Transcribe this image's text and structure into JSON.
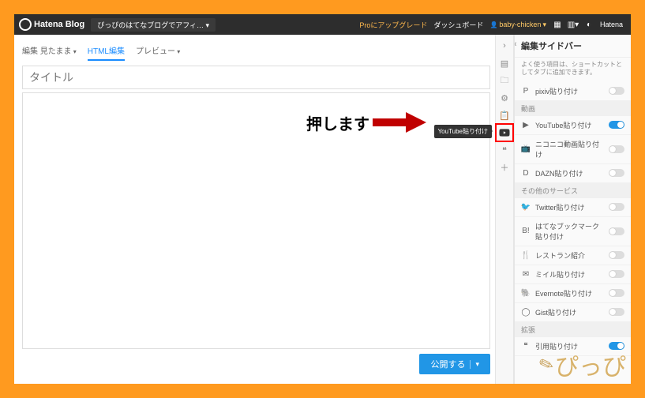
{
  "topbar": {
    "brand": "Hatena Blog",
    "blogname": "ぴっぴのはてなブログでアフィ…",
    "pro": "Proにアップグレード",
    "dashboard": "ダッシュボード",
    "user": "baby-chicken",
    "hatena": "Hatena"
  },
  "tabs": {
    "edit": "編集 見たまま",
    "html": "HTML編集",
    "preview": "プレビュー"
  },
  "editor": {
    "title_placeholder": "タイトル",
    "publish": "公開する"
  },
  "rail": {
    "tooltip": "YouTube貼り付け"
  },
  "sidebar": {
    "title": "編集サイドバー",
    "note": "よく使う項目は、ショートカットとしてタブに追加できます。",
    "sec_video": "動画",
    "sec_other": "その他のサービス",
    "sec_ext": "拡張",
    "items": {
      "pixiv": "pixiv貼り付け",
      "youtube": "YouTube貼り付け",
      "niconico": "ニコニコ動画貼り付け",
      "dazn": "DAZN貼り付け",
      "twitter": "Twitter貼り付け",
      "bookmark": "はてなブックマーク貼り付け",
      "restaurant": "レストラン紹介",
      "mail": "ミイル貼り付け",
      "evernote": "Evernote貼り付け",
      "gist": "Gist貼り付け",
      "quote": "引用貼り付け"
    }
  },
  "annotation": {
    "text": "押します"
  },
  "watermark": "ぴっぴ"
}
